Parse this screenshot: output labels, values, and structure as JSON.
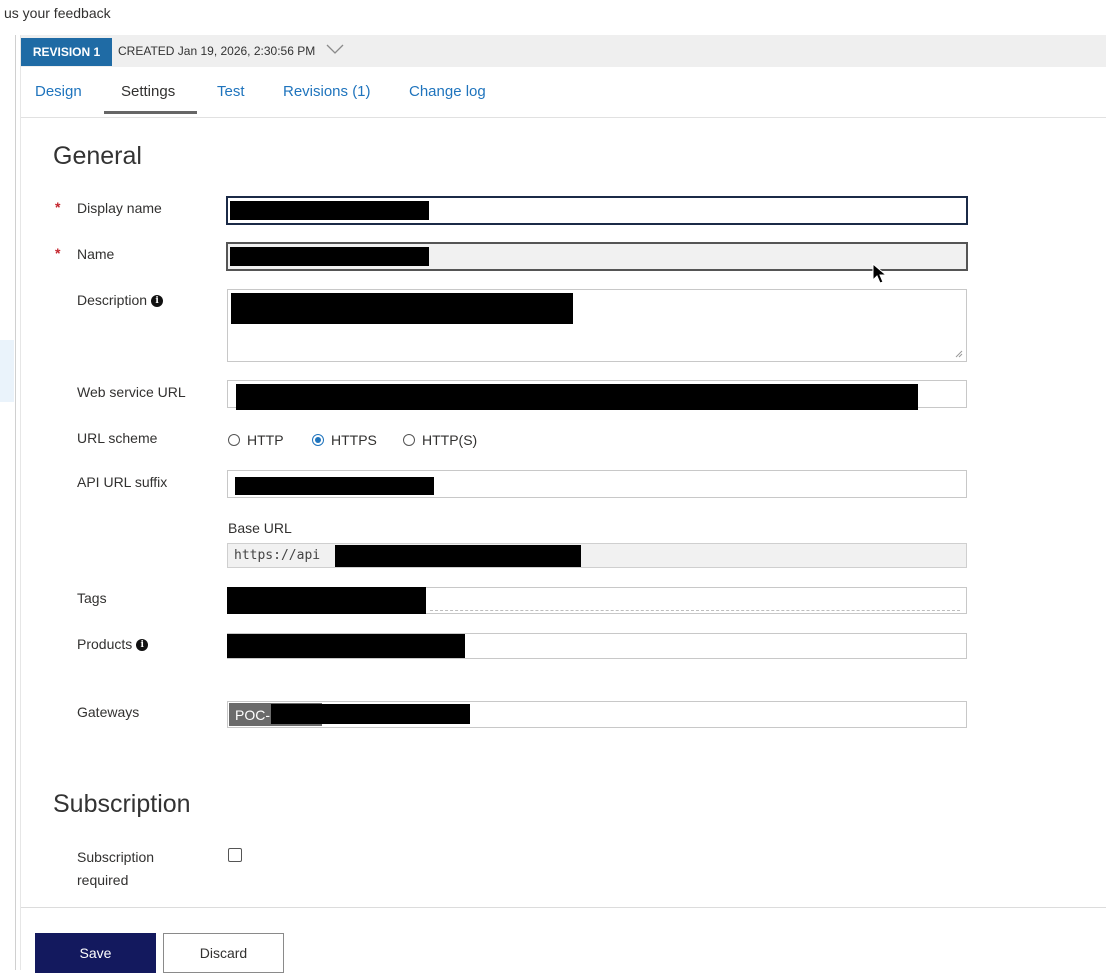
{
  "feedback_text": "us your feedback",
  "revision": {
    "badge": "REVISION 1",
    "created": "CREATED Jan 19, 2026, 2:30:56 PM"
  },
  "tabs": [
    {
      "label": "Design",
      "active": false
    },
    {
      "label": "Settings",
      "active": true
    },
    {
      "label": "Test",
      "active": false
    },
    {
      "label": "Revisions (1)",
      "active": false
    },
    {
      "label": "Change log",
      "active": false
    }
  ],
  "general": {
    "title": "General",
    "display_name_label": "Display name",
    "name_label": "Name",
    "description_label": "Description",
    "web_service_url_label": "Web service URL",
    "url_scheme_label": "URL scheme",
    "url_scheme_options": [
      "HTTP",
      "HTTPS",
      "HTTP(S)"
    ],
    "url_scheme_selected": "HTTPS",
    "api_url_suffix_label": "API URL suffix",
    "base_url_label": "Base URL",
    "base_url_value": "https://api",
    "tags_label": "Tags",
    "products_label": "Products",
    "gateways_label": "Gateways",
    "gateway_chip": "POC-"
  },
  "subscription": {
    "title": "Subscription",
    "required_label_line1": "Subscription",
    "required_label_line2": "required",
    "required_checked": false
  },
  "buttons": {
    "save": "Save",
    "discard": "Discard"
  },
  "colors": {
    "accent": "#1f74bd",
    "revision_badge": "#1f6ba5",
    "save_button": "#13195e",
    "required_asterisk": "#c4262e"
  }
}
